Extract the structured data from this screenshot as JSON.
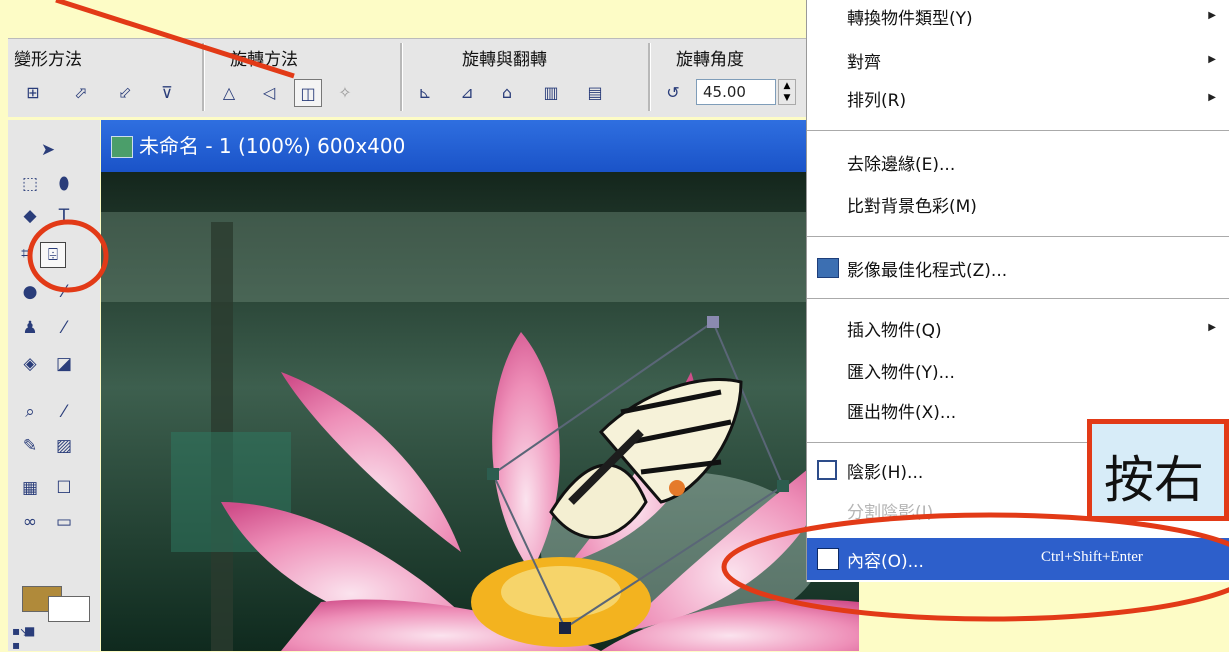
{
  "toolbar": {
    "groups": [
      "變形方法",
      "旋轉方法",
      "旋轉與翻轉",
      "旋轉角度"
    ],
    "angle_value": "45.00"
  },
  "document": {
    "title": "未命名 - 1 (100%) 600x400"
  },
  "context_menu": {
    "items": [
      {
        "label": "轉換物件類型(Y)",
        "submenu": true
      },
      {
        "label": "對齊",
        "submenu": true
      },
      {
        "label": "排列(R)",
        "submenu": true
      },
      {
        "label": "去除邊緣(E)..."
      },
      {
        "label": "比對背景色彩(M)"
      },
      {
        "label": "影像最佳化程式(Z)..."
      },
      {
        "label": "插入物件(Q)",
        "submenu": true
      },
      {
        "label": "匯入物件(Y)..."
      },
      {
        "label": "匯出物件(X)..."
      },
      {
        "label": "陰影(H)..."
      },
      {
        "label": "分割陰影(I)",
        "disabled": true
      },
      {
        "label": "內容(O)...",
        "shortcut": "Ctrl+Shift+Enter",
        "highlighted": true
      }
    ]
  },
  "annotation": {
    "text": "按右"
  },
  "colors": {
    "background": "#fdfcc6",
    "highlight_blue": "#2d5fcb",
    "annotation_red": "#e23a17",
    "titlebar_blue": "#1a53c8"
  }
}
